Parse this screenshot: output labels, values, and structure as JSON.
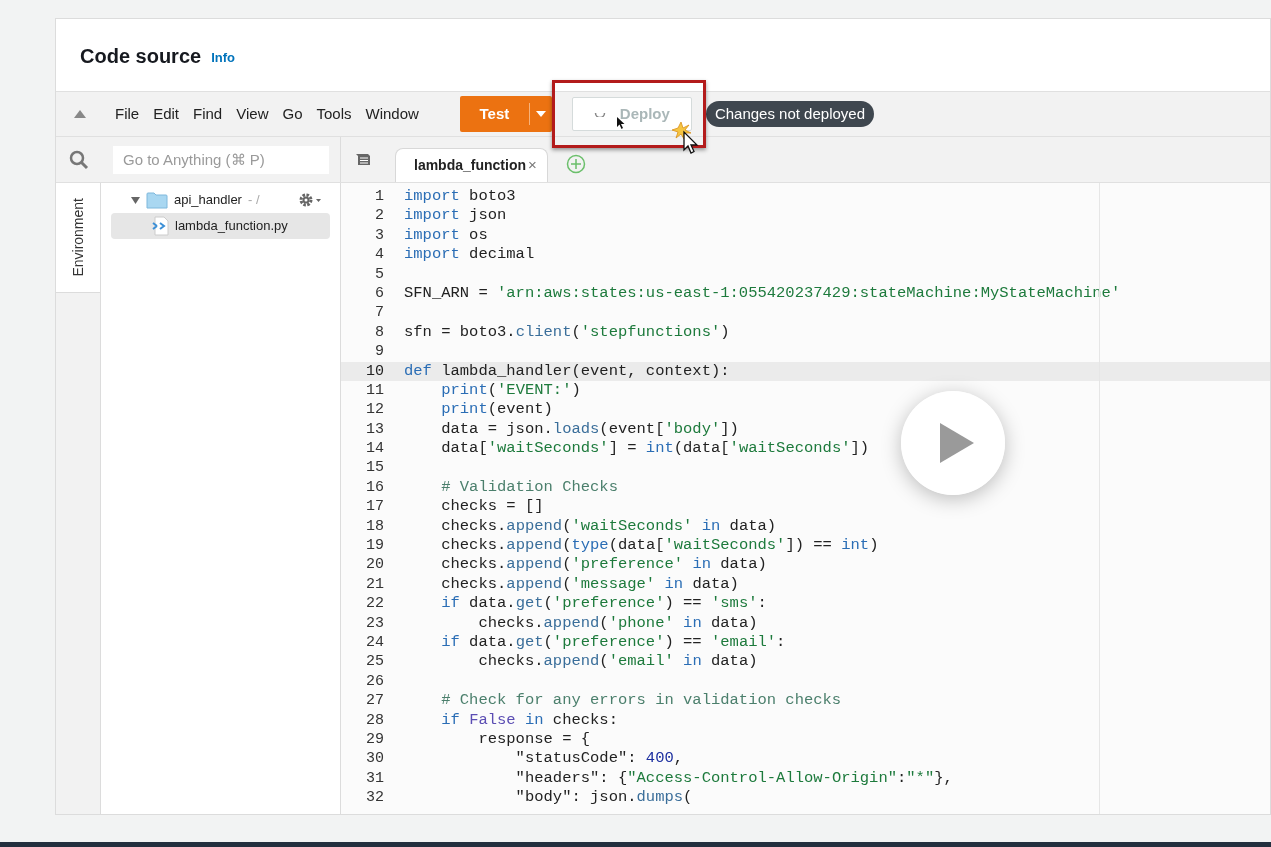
{
  "header": {
    "title": "Code source",
    "info_link": "Info"
  },
  "menu": [
    "File",
    "Edit",
    "Find",
    "View",
    "Go",
    "Tools",
    "Window"
  ],
  "test_button": {
    "label": "Test"
  },
  "deploy_button": {
    "label": "Deploy",
    "disabled": true
  },
  "status_badge": "Changes not deployed",
  "search": {
    "placeholder": "Go to Anything (⌘ P)"
  },
  "side_tabs": [
    {
      "label": "Environment",
      "selected": true
    }
  ],
  "tree": [
    {
      "kind": "folder",
      "name": "api_handler",
      "suffix": "- /",
      "expanded": true,
      "children": [
        {
          "kind": "file",
          "name": "lambda_function.py",
          "selected": true
        }
      ]
    }
  ],
  "editor_tabs": [
    {
      "label": "lambda_function",
      "selected": true,
      "close": "×"
    }
  ],
  "code": [
    {
      "number": "1",
      "selected": false,
      "tokens": [
        {
          "kind": "keyword",
          "text": "import"
        },
        {
          "kind": "plain",
          "text": " boto3"
        }
      ]
    },
    {
      "number": "2",
      "selected": false,
      "tokens": [
        {
          "kind": "keyword",
          "text": "import"
        },
        {
          "kind": "plain",
          "text": " json"
        }
      ]
    },
    {
      "number": "3",
      "selected": false,
      "tokens": [
        {
          "kind": "keyword",
          "text": "import"
        },
        {
          "kind": "plain",
          "text": " os"
        }
      ]
    },
    {
      "number": "4",
      "selected": false,
      "tokens": [
        {
          "kind": "keyword",
          "text": "import"
        },
        {
          "kind": "plain",
          "text": " decimal"
        }
      ]
    },
    {
      "number": "5",
      "selected": false
    },
    {
      "number": "6",
      "selected": false,
      "tokens": [
        {
          "kind": "plain",
          "text": "SFN_ARN = "
        },
        {
          "kind": "string",
          "text": "'arn:aws:states:us-east-1:055420237429:stateMachine:MyStateMachine'"
        }
      ]
    },
    {
      "number": "7",
      "selected": false
    },
    {
      "number": "8",
      "selected": false,
      "tokens": [
        {
          "kind": "plain",
          "text": "sfn = boto3."
        },
        {
          "kind": "method",
          "text": "client"
        },
        {
          "kind": "plain",
          "text": "("
        },
        {
          "kind": "string",
          "text": "'stepfunctions'"
        },
        {
          "kind": "plain",
          "text": ")"
        }
      ]
    },
    {
      "number": "9",
      "selected": false
    },
    {
      "number": "10",
      "selected": true,
      "tokens": [
        {
          "kind": "keyword",
          "text": "def"
        },
        {
          "kind": "plain",
          "text": " lambda_handler(event, context):"
        }
      ]
    },
    {
      "number": "11",
      "selected": false,
      "tokens": [
        {
          "kind": "keyword",
          "text": "    print"
        },
        {
          "kind": "plain",
          "text": "("
        },
        {
          "kind": "string",
          "text": "'EVENT:'"
        },
        {
          "kind": "plain",
          "text": ")"
        }
      ]
    },
    {
      "number": "12",
      "selected": false,
      "tokens": [
        {
          "kind": "keyword",
          "text": "    print"
        },
        {
          "kind": "plain",
          "text": "(event)"
        }
      ]
    },
    {
      "number": "13",
      "selected": false,
      "tokens": [
        {
          "kind": "plain",
          "text": "    data = json."
        },
        {
          "kind": "method",
          "text": "loads"
        },
        {
          "kind": "plain",
          "text": "(event["
        },
        {
          "kind": "string",
          "text": "'body'"
        },
        {
          "kind": "plain",
          "text": "])"
        }
      ]
    },
    {
      "number": "14",
      "selected": false,
      "tokens": [
        {
          "kind": "plain",
          "text": "    data["
        },
        {
          "kind": "string",
          "text": "'waitSeconds'"
        },
        {
          "kind": "plain",
          "text": "] = "
        },
        {
          "kind": "keyword",
          "text": "int"
        },
        {
          "kind": "plain",
          "text": "(data["
        },
        {
          "kind": "string",
          "text": "'waitSeconds'"
        },
        {
          "kind": "plain",
          "text": "])"
        }
      ]
    },
    {
      "number": "15",
      "selected": false
    },
    {
      "number": "16",
      "selected": false,
      "tokens": [
        {
          "kind": "comment",
          "text": "    # Validation Checks"
        }
      ]
    },
    {
      "number": "17",
      "selected": false,
      "tokens": [
        {
          "kind": "plain",
          "text": "    checks = []"
        }
      ]
    },
    {
      "number": "18",
      "selected": false,
      "tokens": [
        {
          "kind": "plain",
          "text": "    checks."
        },
        {
          "kind": "method",
          "text": "append"
        },
        {
          "kind": "plain",
          "text": "("
        },
        {
          "kind": "string",
          "text": "'waitSeconds'"
        },
        {
          "kind": "keyword",
          "text": " in"
        },
        {
          "kind": "plain",
          "text": " data)"
        }
      ]
    },
    {
      "number": "19",
      "selected": false,
      "tokens": [
        {
          "kind": "plain",
          "text": "    checks."
        },
        {
          "kind": "method",
          "text": "append"
        },
        {
          "kind": "plain",
          "text": "("
        },
        {
          "kind": "keyword",
          "text": "type"
        },
        {
          "kind": "plain",
          "text": "(data["
        },
        {
          "kind": "string",
          "text": "'waitSeconds'"
        },
        {
          "kind": "plain",
          "text": "]) == "
        },
        {
          "kind": "keyword",
          "text": "int"
        },
        {
          "kind": "plain",
          "text": ")"
        }
      ]
    },
    {
      "number": "20",
      "selected": false,
      "tokens": [
        {
          "kind": "plain",
          "text": "    checks."
        },
        {
          "kind": "method",
          "text": "append"
        },
        {
          "kind": "plain",
          "text": "("
        },
        {
          "kind": "string",
          "text": "'preference'"
        },
        {
          "kind": "keyword",
          "text": " in"
        },
        {
          "kind": "plain",
          "text": " data)"
        }
      ]
    },
    {
      "number": "21",
      "selected": false,
      "tokens": [
        {
          "kind": "plain",
          "text": "    checks."
        },
        {
          "kind": "method",
          "text": "append"
        },
        {
          "kind": "plain",
          "text": "("
        },
        {
          "kind": "string",
          "text": "'message'"
        },
        {
          "kind": "keyword",
          "text": " in"
        },
        {
          "kind": "plain",
          "text": " data)"
        }
      ]
    },
    {
      "number": "22",
      "selected": false,
      "tokens": [
        {
          "kind": "keyword",
          "text": "    if"
        },
        {
          "kind": "plain",
          "text": " data."
        },
        {
          "kind": "method",
          "text": "get"
        },
        {
          "kind": "plain",
          "text": "("
        },
        {
          "kind": "string",
          "text": "'preference'"
        },
        {
          "kind": "plain",
          "text": ") == "
        },
        {
          "kind": "string",
          "text": "'sms'"
        },
        {
          "kind": "plain",
          "text": ":"
        }
      ]
    },
    {
      "number": "23",
      "selected": false,
      "tokens": [
        {
          "kind": "plain",
          "text": "        checks."
        },
        {
          "kind": "method",
          "text": "append"
        },
        {
          "kind": "plain",
          "text": "("
        },
        {
          "kind": "string",
          "text": "'phone'"
        },
        {
          "kind": "keyword",
          "text": " in"
        },
        {
          "kind": "plain",
          "text": " data)"
        }
      ]
    },
    {
      "number": "24",
      "selected": false,
      "tokens": [
        {
          "kind": "keyword",
          "text": "    if"
        },
        {
          "kind": "plain",
          "text": " data."
        },
        {
          "kind": "method",
          "text": "get"
        },
        {
          "kind": "plain",
          "text": "("
        },
        {
          "kind": "string",
          "text": "'preference'"
        },
        {
          "kind": "plain",
          "text": ") == "
        },
        {
          "kind": "string",
          "text": "'email'"
        },
        {
          "kind": "plain",
          "text": ":"
        }
      ]
    },
    {
      "number": "25",
      "selected": false,
      "tokens": [
        {
          "kind": "plain",
          "text": "        checks."
        },
        {
          "kind": "method",
          "text": "append"
        },
        {
          "kind": "plain",
          "text": "("
        },
        {
          "kind": "string",
          "text": "'email'"
        },
        {
          "kind": "keyword",
          "text": " in"
        },
        {
          "kind": "plain",
          "text": " data)"
        }
      ]
    },
    {
      "number": "26",
      "selected": false
    },
    {
      "number": "27",
      "selected": false,
      "tokens": [
        {
          "kind": "comment",
          "text": "    # Check for any errors in validation checks"
        }
      ]
    },
    {
      "number": "28",
      "selected": false,
      "tokens": [
        {
          "kind": "keyword",
          "text": "    if "
        },
        {
          "kind": "constant",
          "text": "False"
        },
        {
          "kind": "keyword",
          "text": " in"
        },
        {
          "kind": "plain",
          "text": " checks:"
        }
      ]
    },
    {
      "number": "29",
      "selected": false,
      "tokens": [
        {
          "kind": "plain",
          "text": "        response = {"
        }
      ]
    },
    {
      "number": "30",
      "selected": false,
      "tokens": [
        {
          "kind": "plain",
          "text": "            \"statusCode\": "
        },
        {
          "kind": "number",
          "text": "400"
        },
        {
          "kind": "plain",
          "text": ","
        }
      ]
    },
    {
      "number": "31",
      "selected": false,
      "tokens": [
        {
          "kind": "plain",
          "text": "            \"headers\": {"
        },
        {
          "kind": "string",
          "text": "\"Access-Control-Allow-Origin\""
        },
        {
          "kind": "plain",
          "text": ":"
        },
        {
          "kind": "string",
          "text": "\"*\""
        },
        {
          "kind": "plain",
          "text": "},"
        }
      ]
    },
    {
      "number": "32",
      "selected": false,
      "tokens": [
        {
          "kind": "plain",
          "text": "            \"body\": json."
        },
        {
          "kind": "method",
          "text": "dumps"
        },
        {
          "kind": "plain",
          "text": "("
        }
      ]
    }
  ]
}
